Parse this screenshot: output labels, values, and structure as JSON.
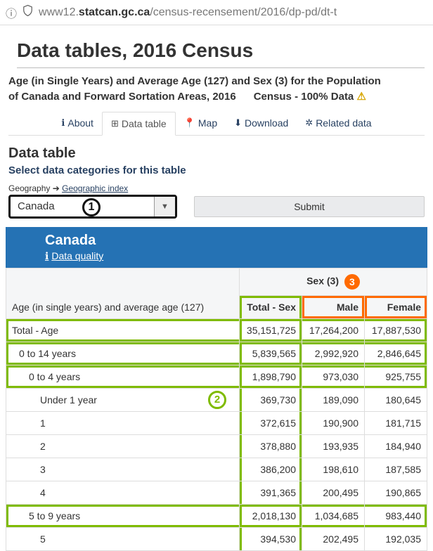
{
  "url": {
    "prefix": "www12.",
    "bold": "statcan.gc.ca",
    "suffix": "/census-recensement/2016/dp-pd/dt-t"
  },
  "page_title": "Data tables, 2016 Census",
  "subtitle_line1": "Age (in Single Years) and Average Age (127) and Sex (3) for the Population",
  "subtitle_line2a": "of Canada and Forward Sortation Areas, 2016",
  "subtitle_line2b": "Census - 100% Data",
  "tabs": {
    "about": "About",
    "data_table": "Data table",
    "map": "Map",
    "download": "Download",
    "related": "Related data"
  },
  "section_title": "Data table",
  "select_categories": "Select data categories for this table",
  "geo_label": "Geography",
  "geo_index_link": "Geographic index",
  "geo_selected": "Canada",
  "submit_label": "Submit",
  "markers": {
    "one": "1",
    "two": "2",
    "three": "3"
  },
  "table_header": {
    "region": "Canada",
    "data_quality": "Data quality"
  },
  "columns": {
    "age": "Age (in single years) and average age (127)",
    "sex_group": "Sex (3)",
    "total": "Total - Sex",
    "male": "Male",
    "female": "Female"
  },
  "rows": [
    {
      "label": "Total - Age",
      "indent": 0,
      "total": "35,151,725",
      "male": "17,264,200",
      "female": "17,887,530",
      "hl": true
    },
    {
      "label": "0 to 14 years",
      "indent": 1,
      "total": "5,839,565",
      "male": "2,992,920",
      "female": "2,846,645",
      "hl": true
    },
    {
      "label": "0 to 4 years",
      "indent": 2,
      "total": "1,898,790",
      "male": "973,030",
      "female": "925,755",
      "hl": true
    },
    {
      "label": "Under 1 year",
      "indent": 3,
      "total": "369,730",
      "male": "189,090",
      "female": "180,645",
      "marker2": true
    },
    {
      "label": "1",
      "indent": 3,
      "total": "372,615",
      "male": "190,900",
      "female": "181,715"
    },
    {
      "label": "2",
      "indent": 3,
      "total": "378,880",
      "male": "193,935",
      "female": "184,940"
    },
    {
      "label": "3",
      "indent": 3,
      "total": "386,200",
      "male": "198,610",
      "female": "187,585"
    },
    {
      "label": "4",
      "indent": 3,
      "total": "391,365",
      "male": "200,495",
      "female": "190,865"
    },
    {
      "label": "5 to 9 years",
      "indent": 2,
      "total": "2,018,130",
      "male": "1,034,685",
      "female": "983,440",
      "hl": true
    },
    {
      "label": "5",
      "indent": 3,
      "total": "394,530",
      "male": "202,495",
      "female": "192,035"
    }
  ]
}
